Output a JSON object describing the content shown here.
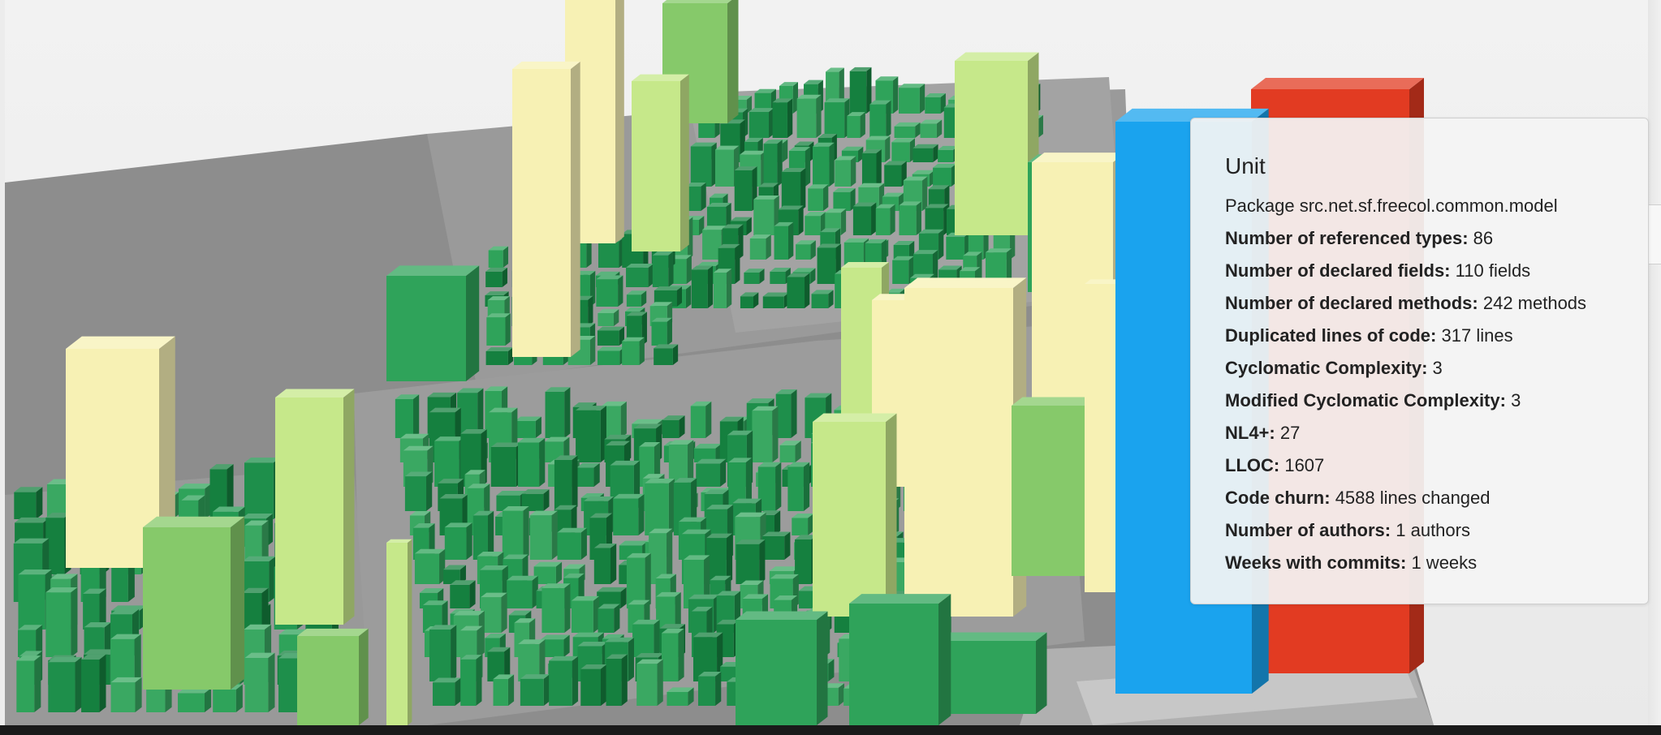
{
  "app": {
    "name": "code-city-3d-view"
  },
  "tooltip": {
    "title": "Unit",
    "subtitle": "Package src.net.sf.freecol.common.model",
    "metrics": [
      {
        "label": "Number of referenced types:",
        "value": "86"
      },
      {
        "label": "Number of declared fields:",
        "value": "110 fields"
      },
      {
        "label": "Number of declared methods:",
        "value": "242 methods"
      },
      {
        "label": "Duplicated lines of code:",
        "value": "317 lines"
      },
      {
        "label": "Cyclomatic Complexity:",
        "value": "3"
      },
      {
        "label": "Modified Cyclomatic Complexity:",
        "value": "3"
      },
      {
        "label": "NL4+:",
        "value": "27"
      },
      {
        "label": "LLOC:",
        "value": "1607"
      },
      {
        "label": "Code churn:",
        "value": "4588 lines changed"
      },
      {
        "label": "Number of authors:",
        "value": "1 authors"
      },
      {
        "label": "Weeks with commits:",
        "value": "1 weeks"
      }
    ]
  },
  "colors": {
    "background": "#efefef",
    "platform": "#8f8f8f",
    "platform_light": "#b5b5b5",
    "green_dark": "#15803f",
    "green": "#2fa35a",
    "green_light": "#86c96a",
    "yellow_green": "#c6e88a",
    "pale_yellow": "#f7f1b4",
    "highlight_blue": "#1aa3ee",
    "highlight_red": "#e23b22"
  }
}
